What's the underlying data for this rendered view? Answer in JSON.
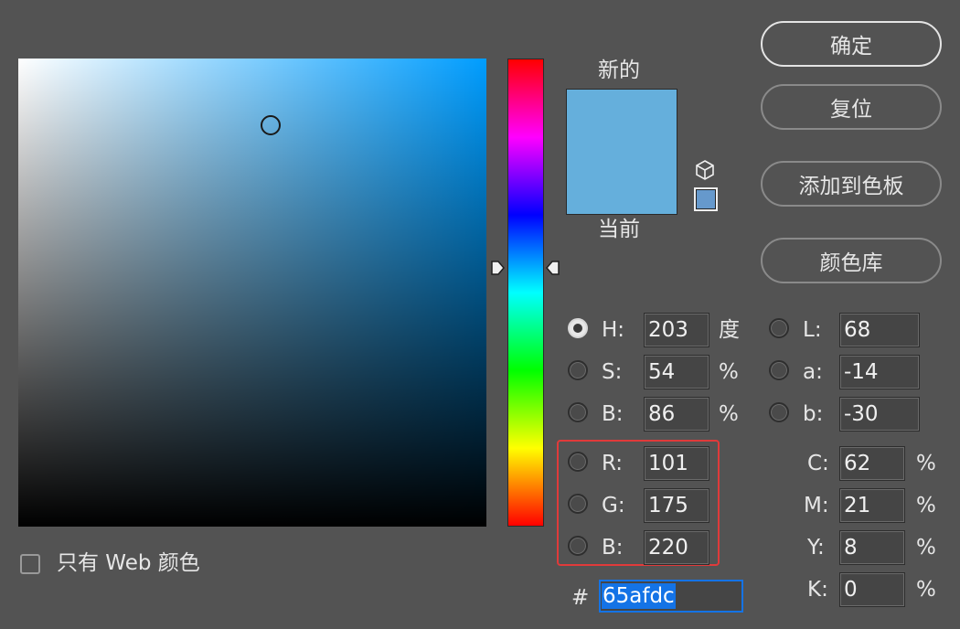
{
  "picker": {
    "selected_color": "#65afdc",
    "field_hue_color": "#009dff",
    "web_only_label": "只有 Web 颜色",
    "web_only_checked": false
  },
  "preview": {
    "new_label": "新的",
    "current_label": "当前",
    "new_color": "#65afdc",
    "current_color": "#65afdc"
  },
  "buttons": {
    "ok": "确定",
    "reset": "复位",
    "add_to_swatches": "添加到色板",
    "color_libraries": "颜色库"
  },
  "hsb": [
    {
      "label": "H:",
      "value": "203",
      "unit": "度",
      "selected": true
    },
    {
      "label": "S:",
      "value": "54",
      "unit": "%",
      "selected": false
    },
    {
      "label": "B:",
      "value": "86",
      "unit": "%",
      "selected": false
    }
  ],
  "rgb": [
    {
      "label": "R:",
      "value": "101"
    },
    {
      "label": "G:",
      "value": "175"
    },
    {
      "label": "B:",
      "value": "220"
    }
  ],
  "lab": [
    {
      "label": "L:",
      "value": "68"
    },
    {
      "label": "a:",
      "value": "-14"
    },
    {
      "label": "b:",
      "value": "-30"
    }
  ],
  "cmyk": [
    {
      "label": "C:",
      "value": "62",
      "unit": "%"
    },
    {
      "label": "M:",
      "value": "21",
      "unit": "%"
    },
    {
      "label": "Y:",
      "value": "8",
      "unit": "%"
    },
    {
      "label": "K:",
      "value": "0",
      "unit": "%"
    }
  ],
  "hex": {
    "prefix": "#",
    "value": "65afdc"
  },
  "highlight_color": "#e03a3a"
}
